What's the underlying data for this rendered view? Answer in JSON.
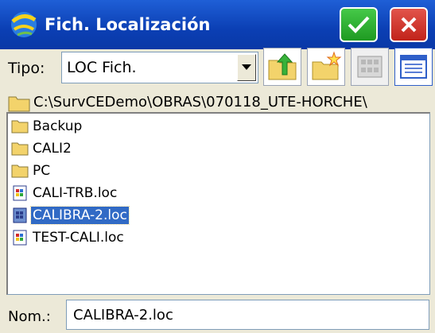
{
  "window": {
    "title": "Fich. Localización",
    "ok_icon": "checkmark-icon",
    "close_icon": "close-icon",
    "ok_color": "#2db32f",
    "close_color": "#d2342a",
    "titlebar_color": "#0b3fb4"
  },
  "toolbar": {
    "tipo_label": "Tipo:",
    "tipo_value": "LOC Fich.",
    "buttons": [
      "folder-up-icon",
      "new-folder-icon",
      "grid-view-icon",
      "list-view-icon"
    ]
  },
  "path": {
    "value": "C:\\SurvCEDemo\\OBRAS\\070118_UTE-HORCHE\\"
  },
  "files": [
    {
      "label": "Backup",
      "type": "folder"
    },
    {
      "label": "CALI2",
      "type": "folder"
    },
    {
      "label": "PC",
      "type": "folder"
    },
    {
      "label": "CALI-TRB.loc",
      "type": "file"
    },
    {
      "label": "CALIBRA-2.loc",
      "type": "file",
      "selected": true
    },
    {
      "label": "TEST-CALI.loc",
      "type": "file"
    }
  ],
  "name_field": {
    "label": "Nom.:",
    "value": "CALIBRA-2.loc"
  },
  "selection_color": "#316ac5"
}
